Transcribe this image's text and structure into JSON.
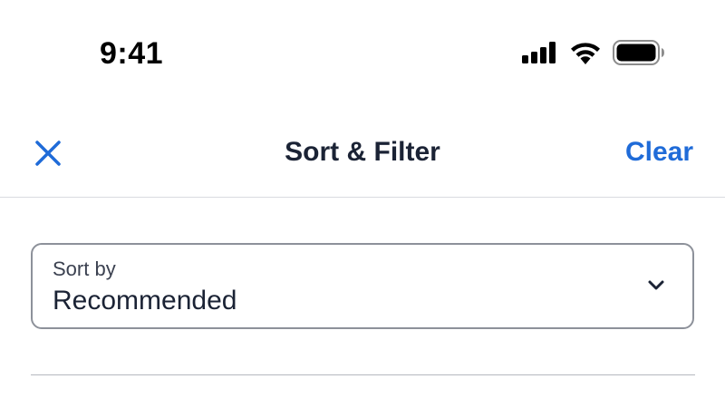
{
  "status_bar": {
    "time": "9:41",
    "icons": [
      "cellular-signal-icon",
      "wifi-icon",
      "battery-icon"
    ]
  },
  "header": {
    "close_icon": "close-icon",
    "title": "Sort & Filter",
    "clear_label": "Clear"
  },
  "sort": {
    "label": "Sort by",
    "value": "Recommended",
    "icon": "chevron-down-icon"
  },
  "colors": {
    "accent": "#1f6bd8",
    "text": "#1b2335",
    "border": "#8d919a",
    "divider": "#d9dbe0"
  }
}
